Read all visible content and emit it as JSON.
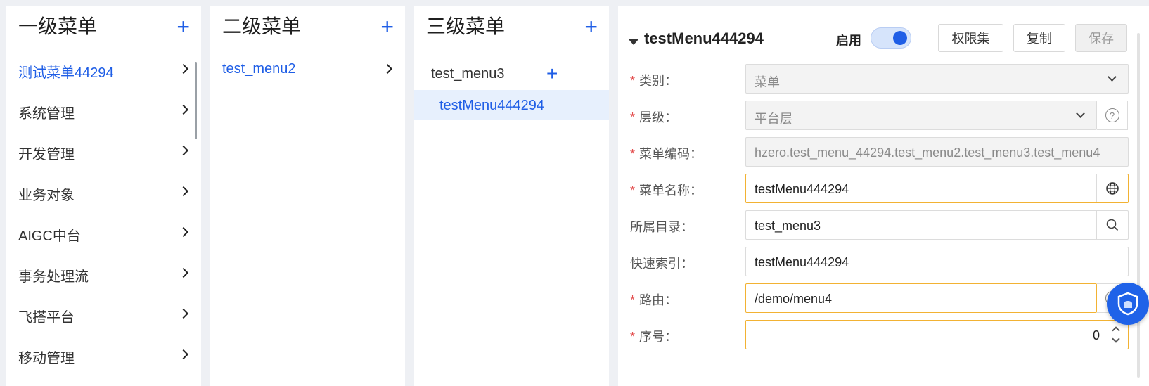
{
  "level1": {
    "title": "一级菜单",
    "items": [
      "测试菜单44294",
      "系统管理",
      "开发管理",
      "业务对象",
      "AIGC中台",
      "事务处理流",
      "飞搭平台",
      "移动管理"
    ]
  },
  "level2": {
    "title": "二级菜单",
    "items": [
      "test_menu2"
    ]
  },
  "level3": {
    "title": "三级菜单",
    "group": "test_menu3",
    "selected": "testMenu444294"
  },
  "detail": {
    "title": "testMenu444294",
    "enable_label": "启用",
    "enabled": true,
    "buttons": {
      "permission": "权限集",
      "copy": "复制",
      "save": "保存"
    },
    "fields": {
      "category": {
        "label": "类别：",
        "value": "菜单"
      },
      "level": {
        "label": "层级：",
        "value": "平台层"
      },
      "code": {
        "label": "菜单编码：",
        "value": "hzero.test_menu_44294.test_menu2.test_menu3.test_menu4"
      },
      "name": {
        "label": "菜单名称：",
        "value": "testMenu444294"
      },
      "parent": {
        "label": "所属目录：",
        "value": "test_menu3"
      },
      "quick_index": {
        "label": "快速索引：",
        "value": "testMenu444294"
      },
      "route": {
        "label": "路由：",
        "value": "/demo/menu4"
      },
      "order": {
        "label": "序号：",
        "value": "0"
      }
    }
  },
  "colors": {
    "accent": "#1f5ee6",
    "focus": "#f2b233",
    "required": "#e34d4d",
    "selected_bg": "#e7f0fd"
  }
}
